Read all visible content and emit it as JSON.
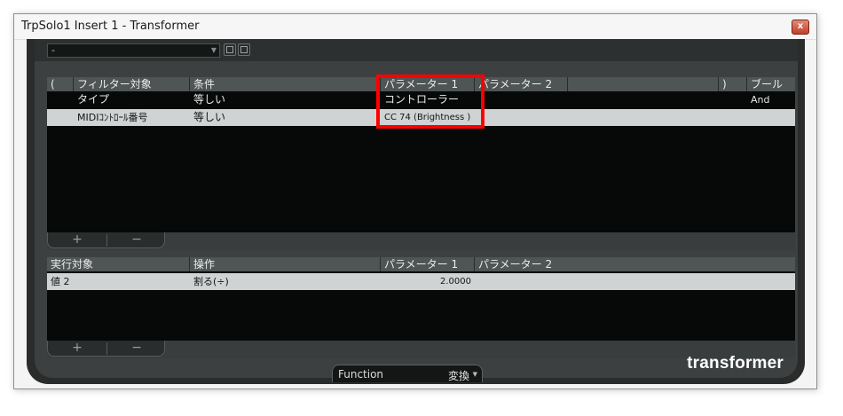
{
  "window": {
    "title": "TrpSolo1 Insert 1 - Transformer",
    "close_label": "x"
  },
  "preset": {
    "value": "-"
  },
  "filter_table": {
    "headers": [
      "(",
      "フィルター対象",
      "条件",
      "パラメーター 1",
      "パラメーター 2",
      "",
      ")",
      "ブール"
    ],
    "rows": [
      {
        "target": "タイプ",
        "condition": "等しい",
        "param1": "コントローラー",
        "param2": "",
        "bool": "And"
      },
      {
        "target": "MIDIｺﾝﾄﾛｰﾙ番号",
        "condition": "等しい",
        "param1": "CC 74  (Brightness )",
        "param2": "",
        "bool": ""
      }
    ]
  },
  "action_table": {
    "headers": [
      "実行対象",
      "操作",
      "パラメーター 1",
      "パラメーター 2"
    ],
    "rows": [
      {
        "target": "値 2",
        "operation": "割る(÷)",
        "param1": "2.0000",
        "param2": ""
      }
    ]
  },
  "buttons": {
    "add": "+",
    "remove": "−"
  },
  "function": {
    "label": "Function",
    "value": "変換"
  },
  "logo": "transformer",
  "colors": {
    "highlight": "#ff0000",
    "selected_row": "#cfd3d3",
    "panel": "#3d4040"
  }
}
